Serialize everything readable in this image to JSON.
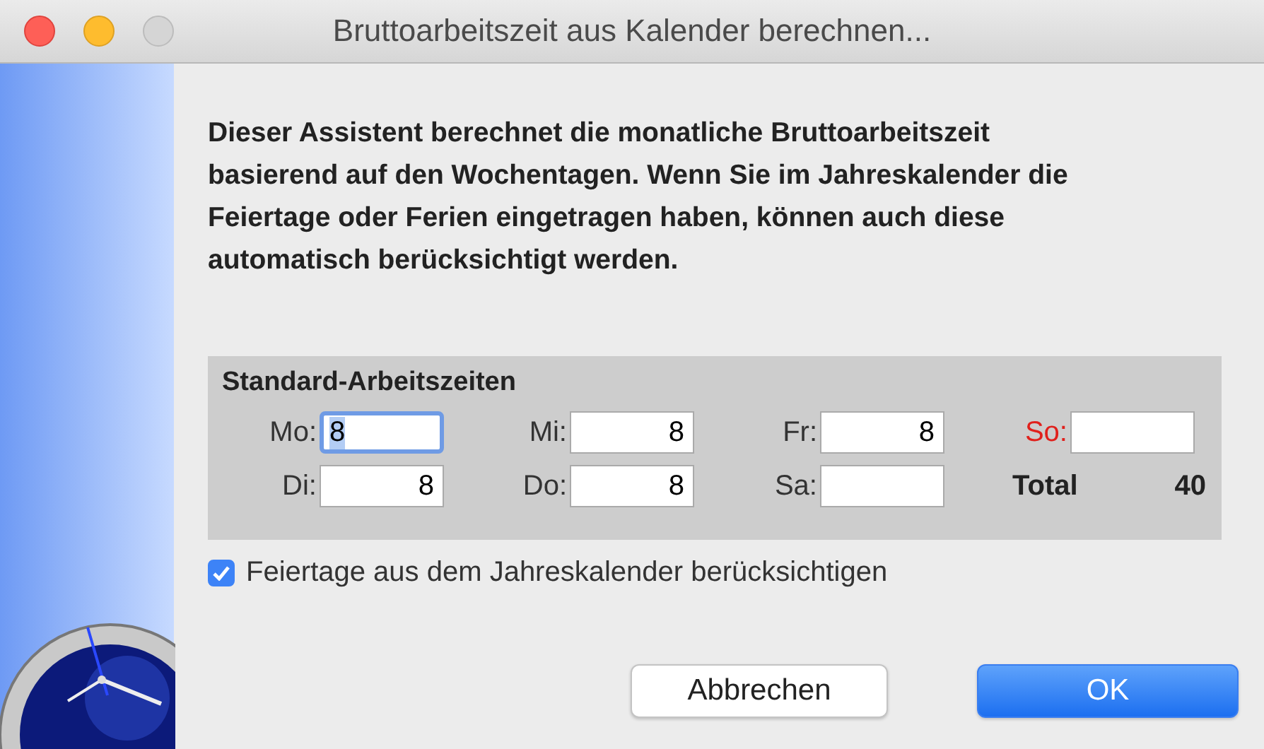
{
  "window": {
    "title": "Bruttoarbeitszeit aus Kalender berechnen..."
  },
  "intro": "Dieser Assistent berechnet die monatliche Bruttoarbeitszeit basierend auf den Wochentagen. Wenn Sie im Jahreskalender die Feiertage oder Ferien eingetragen haben, können auch diese automatisch berücksichtigt werden.",
  "group": {
    "title": "Standard-Arbeitszeiten",
    "fields": [
      {
        "label": "Mo:",
        "value": "8",
        "focused": true,
        "highlighted": false
      },
      {
        "label": "Mi:",
        "value": "8",
        "focused": false,
        "highlighted": false
      },
      {
        "label": "Fr:",
        "value": "8",
        "focused": false,
        "highlighted": false
      },
      {
        "label": "So:",
        "focused": false,
        "highlighted": true
      },
      {
        "label": "Di:",
        "value": "8",
        "focused": false,
        "highlighted": false
      },
      {
        "label": "Do:",
        "value": "8",
        "focused": false,
        "highlighted": false
      },
      {
        "label": "Sa:",
        "focused": false,
        "highlighted": false
      }
    ],
    "total_label": "Total",
    "total_value": "40"
  },
  "checkbox": {
    "label": "Feiertage aus dem Jahreskalender berücksichtigen",
    "checked": true
  },
  "buttons": [
    {
      "label": "Abbrechen",
      "default": false
    },
    {
      "label": "OK",
      "default": true
    }
  ]
}
